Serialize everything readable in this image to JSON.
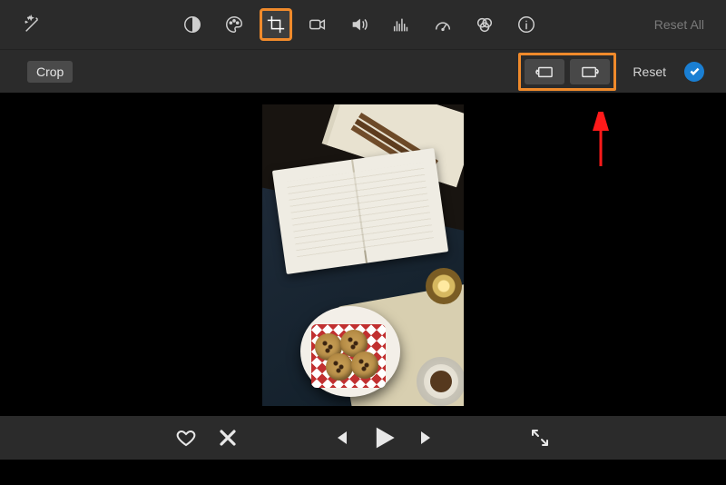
{
  "topbar": {
    "reset_all_label": "Reset All",
    "icons": {
      "magic": "magic-wand-icon",
      "color_balance": "color-balance-icon",
      "palette": "palette-icon",
      "crop": "crop-icon",
      "video": "video-camera-icon",
      "audio": "speaker-icon",
      "noise": "equalizer-icon",
      "speed": "speedometer-icon",
      "filters": "filters-icon",
      "info": "info-icon"
    }
  },
  "subbar": {
    "crop_label": "Crop",
    "rotate_ccw": "rotate-counterclockwise-icon",
    "rotate_cw": "rotate-clockwise-icon",
    "reset_label": "Reset"
  },
  "controls": {
    "favorite": "heart-icon",
    "reject": "x-icon",
    "prev": "previous-icon",
    "play": "play-icon",
    "next": "next-icon",
    "fullscreen": "expand-icon"
  },
  "highlight": {
    "crop_tool_selected": true,
    "rotate_buttons_highlighted": true
  },
  "viewer": {
    "content_description": "Portrait-orientation photo: open book on dark blue textured throw blanket with cream fringe, white plate with red gingham napkin and chocolate-chip cookies, lit tealight candle, cappuccino cup, cinnamon sticks and scattered papers in top corner."
  }
}
